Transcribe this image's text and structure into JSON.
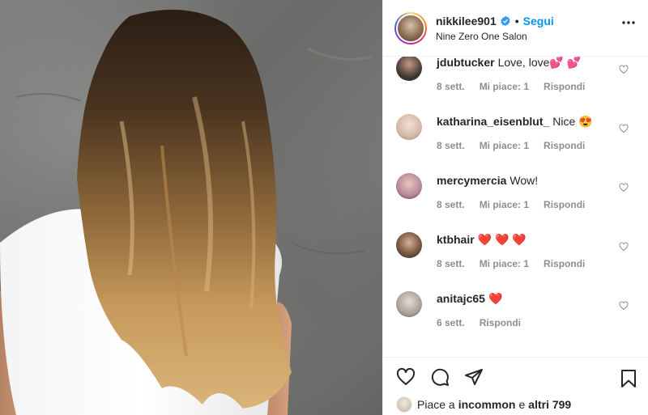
{
  "post": {
    "username": "nikkilee901",
    "follow_label": "Segui",
    "location": "Nine Zero One Salon",
    "verified_icon": "verified-badge-icon",
    "more_icon": "more-options-icon"
  },
  "comments": [
    {
      "username": "jdubtucker",
      "text": "Love, love💕 💕",
      "time": "8 sett.",
      "likes": "Mi piace: 1",
      "reply": "Rispondi",
      "avatar_color": "#3b3430"
    },
    {
      "username": "katharina_eisenblut_",
      "text": "Nice 😍",
      "time": "8 sett.",
      "likes": "Mi piace: 1",
      "reply": "Rispondi",
      "avatar_color": "#e9d8cf"
    },
    {
      "username": "mercymercia",
      "text": "Wow!",
      "time": "8 sett.",
      "likes": "Mi piace: 1",
      "reply": "Rispondi",
      "avatar_color": "#c9a9b8"
    },
    {
      "username": "ktbhair",
      "text": "❤️ ❤️ ❤️",
      "time": "8 sett.",
      "likes": "Mi piace: 1",
      "reply": "Rispondi",
      "avatar_color": "#5b4a3c"
    },
    {
      "username": "anitajc65",
      "text": "❤️",
      "time": "6 sett.",
      "likes": "",
      "reply": "Rispondi",
      "avatar_color": "#b9b2ac"
    }
  ],
  "actions": {
    "like_icon": "heart-icon",
    "comment_icon": "comment-icon",
    "share_icon": "share-icon",
    "save_icon": "bookmark-icon"
  },
  "likes_summary": {
    "prefix": "Piace a",
    "user": "incommon",
    "connector": "e",
    "others": "altri 799"
  },
  "colors": {
    "accent": "#0095f6",
    "text": "#262626",
    "muted": "#8e8e8e"
  }
}
